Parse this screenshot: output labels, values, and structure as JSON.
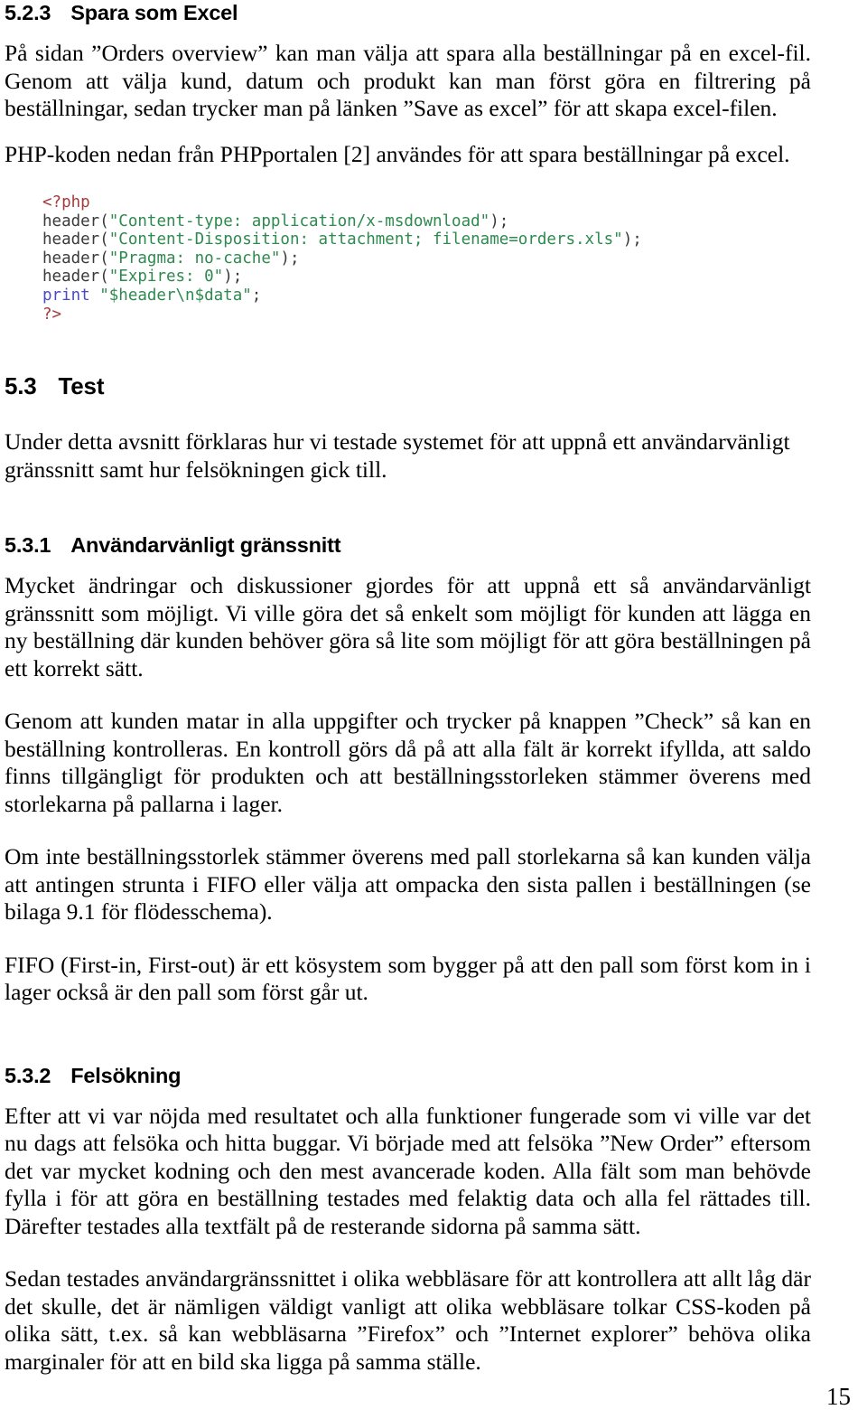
{
  "document": {
    "page_number": "15",
    "language": "sv"
  },
  "sections": {
    "s523": {
      "number": "5.2.3",
      "title": "Spara som Excel",
      "paragraphs": [
        "På sidan ”Orders overview” kan man välja att spara alla beställningar på en excel-fil. Genom att välja kund, datum och produkt kan man först göra en filtrering på beställningar, sedan trycker man på länken ”Save as excel” för att skapa excel-filen.",
        "PHP-koden nedan från PHPportalen [2] användes för att spara beställningar på excel."
      ]
    },
    "s53": {
      "number": "5.3",
      "title": "Test",
      "paragraphs": [
        "Under detta avsnitt förklaras hur vi testade systemet för att uppnå ett användarvänligt gränssnitt samt hur felsökningen gick till."
      ]
    },
    "s531": {
      "number": "5.3.1",
      "title": "Användarvänligt gränssnitt",
      "paragraphs": [
        "Mycket ändringar och diskussioner gjordes för att uppnå ett så användarvänligt gränssnitt som möjligt. Vi ville göra det så enkelt som möjligt för kunden att lägga en ny beställning där kunden behöver göra så lite som möjligt för att göra beställningen på ett korrekt sätt.",
        "Genom att kunden matar in alla uppgifter och trycker på knappen ”Check” så kan en beställning kontrolleras. En kontroll görs då på att alla fält är korrekt ifyllda, att saldo finns tillgängligt för produkten och att beställningsstorleken stämmer överens med storlekarna på pallarna i lager.",
        "Om inte beställningsstorlek stämmer överens med pall storlekarna så kan kunden välja att antingen strunta i FIFO eller välja att ompacka den sista pallen i beställningen (se bilaga 9.1 för flödesschema).",
        "FIFO (First-in, First-out) är ett kösystem som bygger på att den pall som först kom in i lager också är den pall som först går ut."
      ]
    },
    "s532": {
      "number": "5.3.2",
      "title": "Felsökning",
      "paragraphs": [
        "Efter att vi var nöjda med resultatet och alla funktioner fungerade som vi ville var det nu dags att felsöka och hitta buggar. Vi började med att felsöka ”New Order” eftersom det var mycket kodning och den mest avancerade koden. Alla fält som man behövde fylla i för att göra en beställning testades med felaktig data och alla fel rättades till. Därefter testades alla textfält på de resterande sidorna på samma sätt.",
        "Sedan testades användargränssnittet i olika webbläsare för att kontrollera att allt låg där det skulle, det är nämligen väldigt vanligt att olika webbläsare tolkar CSS-koden på olika sätt, t.ex. så kan webbläsarna ”Firefox” och ”Internet explorer” behöva olika marginaler för att en bild ska ligga på samma ställe."
      ]
    }
  },
  "code_block": {
    "language": "php",
    "lines": [
      {
        "tokens": [
          {
            "t": "<?php",
            "c": "tag"
          }
        ]
      },
      {
        "tokens": [
          {
            "t": "header(",
            "c": "fn"
          },
          {
            "t": "\"Content-type: application/x-msdownload\"",
            "c": "str"
          },
          {
            "t": ");",
            "c": "punc"
          }
        ]
      },
      {
        "tokens": [
          {
            "t": "header(",
            "c": "fn"
          },
          {
            "t": "\"Content-Disposition: attachment; filename=orders.xls\"",
            "c": "str"
          },
          {
            "t": ");",
            "c": "punc"
          }
        ]
      },
      {
        "tokens": [
          {
            "t": "header(",
            "c": "fn"
          },
          {
            "t": "\"Pragma: no-cache\"",
            "c": "str"
          },
          {
            "t": ");",
            "c": "punc"
          }
        ]
      },
      {
        "tokens": [
          {
            "t": "header(",
            "c": "fn"
          },
          {
            "t": "\"Expires: 0\"",
            "c": "str"
          },
          {
            "t": ");",
            "c": "punc"
          }
        ]
      },
      {
        "tokens": [
          {
            "t": "print ",
            "c": "kw"
          },
          {
            "t": "\"$header\\n$data\"",
            "c": "str"
          },
          {
            "t": ";",
            "c": "punc"
          }
        ]
      },
      {
        "tokens": [
          {
            "t": "?>",
            "c": "tag"
          }
        ]
      }
    ],
    "colors": {
      "tag": "#a33b3b",
      "string": "#2d8a4e",
      "keyword": "#4a4ac4",
      "default": "#3a3a3a"
    }
  }
}
